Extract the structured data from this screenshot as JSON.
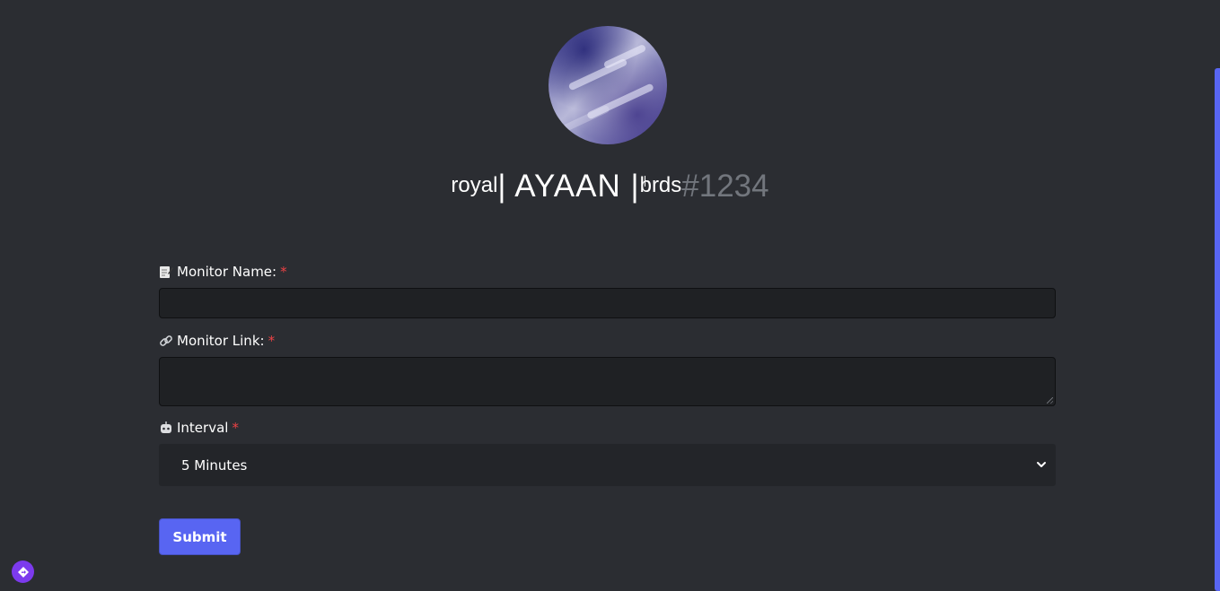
{
  "profile": {
    "username_prefix": "royal",
    "username_main": "| AYAAN |",
    "username_suffix": "brds",
    "discriminator": "#1234"
  },
  "form": {
    "monitor_name": {
      "label": "Monitor Name:",
      "required_mark": "*",
      "icon": "memo-icon",
      "value": ""
    },
    "monitor_link": {
      "label": "Monitor Link:",
      "required_mark": "*",
      "icon": "link-icon",
      "value": ""
    },
    "interval": {
      "label": "Interval",
      "required_mark": "*",
      "icon": "robot-icon",
      "selected": "5 Minutes"
    },
    "submit_label": "Submit"
  },
  "colors": {
    "accent": "#5865f2",
    "background": "#2b2d32",
    "input_bg": "#1f2124",
    "required": "#ed4245",
    "tag": "#72767d"
  }
}
